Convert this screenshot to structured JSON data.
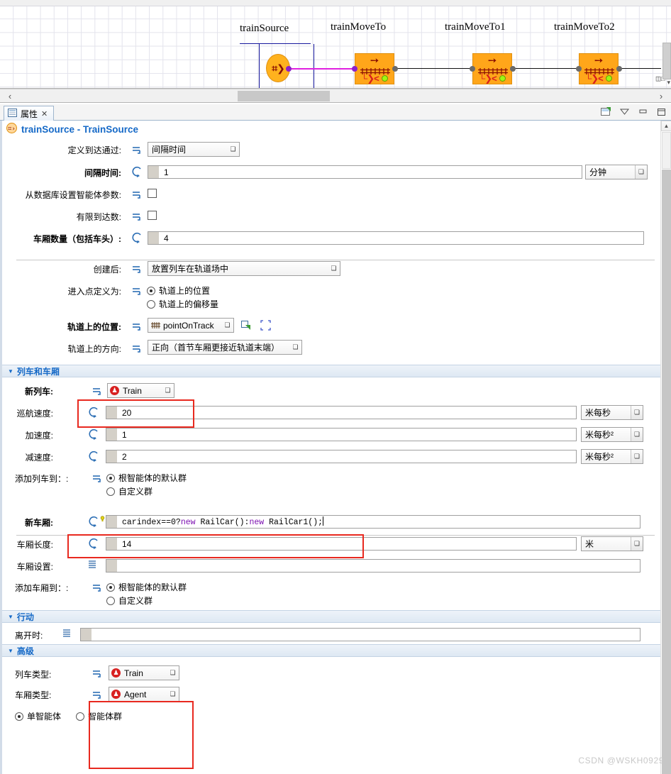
{
  "canvas": {
    "nodes": [
      {
        "name": "trainSource",
        "type": "source"
      },
      {
        "name": "trainMoveTo",
        "type": "moveto"
      },
      {
        "name": "trainMoveTo1",
        "type": "moveto"
      },
      {
        "name": "trainMoveTo2",
        "type": "moveto"
      }
    ],
    "scroll_left_icon": "chevron-left",
    "scroll_right_icon": "chevron-right"
  },
  "tabstrip": {
    "tab_label": "属性",
    "tab_close": "✕",
    "tools": [
      "restore-view-icon",
      "minimize-chevron-icon",
      "minimize-icon",
      "maximize-icon"
    ]
  },
  "props": {
    "title": "trainSource - TrainSource",
    "rows": {
      "arrivals_defined_by": {
        "label": "定义到达通过:",
        "value": "间隔时间"
      },
      "interarrival_time": {
        "label": "间隔时间:",
        "value": "1",
        "unit": "分钟"
      },
      "set_agent_params_from_db": {
        "label": "从数据库设置智能体参数:",
        "checked": false
      },
      "limited_arrivals": {
        "label": "有限到达数:",
        "checked": false
      },
      "cars_count": {
        "label": "车厢数量（包括车头）:",
        "value": "4"
      },
      "after_creation": {
        "label": "创建后:",
        "value": "放置列车在轨道场中"
      },
      "entry_point_defined_as": {
        "label": "进入点定义为:",
        "options": [
          "轨道上的位置",
          "轨道上的偏移量"
        ],
        "selected": 0
      },
      "position_on_track": {
        "label": "轨道上的位置:",
        "value": "pointOnTrack",
        "icon": "track-icon",
        "side_icons": [
          "jump-to-icon",
          "select-region-icon"
        ]
      },
      "direction_on_track": {
        "label": "轨道上的方向:",
        "value": "正向（首节车厢更接近轨道末端）"
      }
    },
    "section_train_cars": {
      "header": "列车和车厢",
      "new_train": {
        "label": "新列车:",
        "value": "Train"
      },
      "cruise_speed": {
        "label": "巡航速度:",
        "value": "20",
        "unit": "米每秒"
      },
      "acceleration": {
        "label": "加速度:",
        "value": "1",
        "unit": "米每秒²"
      },
      "deceleration": {
        "label": "减速度:",
        "value": "2",
        "unit": "米每秒²"
      },
      "add_train_to": {
        "label": "添加列车到：:",
        "options": [
          "根智能体的默认群",
          "自定义群"
        ],
        "selected": 0
      },
      "new_car": {
        "label": "新车厢:",
        "code_plain_1": "carindex==0?",
        "code_kw_1": "new",
        "code_plain_2": " RailCar():",
        "code_kw_2": "new",
        "code_plain_3": " RailCar1();"
      },
      "car_length": {
        "label": "车厢长度:",
        "value": "14",
        "unit": "米"
      },
      "car_setup": {
        "label": "车厢设置:",
        "value": ""
      },
      "add_car_to": {
        "label": "添加车厢到：:",
        "options": [
          "根智能体的默认群",
          "自定义群"
        ],
        "selected": 0
      }
    },
    "section_actions": {
      "header": "行动",
      "on_exit": {
        "label": "离开时:",
        "value": ""
      }
    },
    "section_advanced": {
      "header": "高级",
      "train_type": {
        "label": "列车类型:",
        "value": "Train"
      },
      "car_type": {
        "label": "车厢类型:",
        "value": "Agent"
      },
      "agent_mode": {
        "options": [
          "单智能体",
          "智能体群"
        ],
        "selected": 0
      }
    },
    "scroll_up_icon": "chevron-up-icon"
  },
  "watermark": "CSDN @WSKH0929",
  "colors": {
    "accent_blue": "#1569c7",
    "block_orange": "#FFA61A",
    "highlight_red": "#e8291f",
    "agent_red": "#d82020",
    "link_magenta": "#e020e0"
  }
}
